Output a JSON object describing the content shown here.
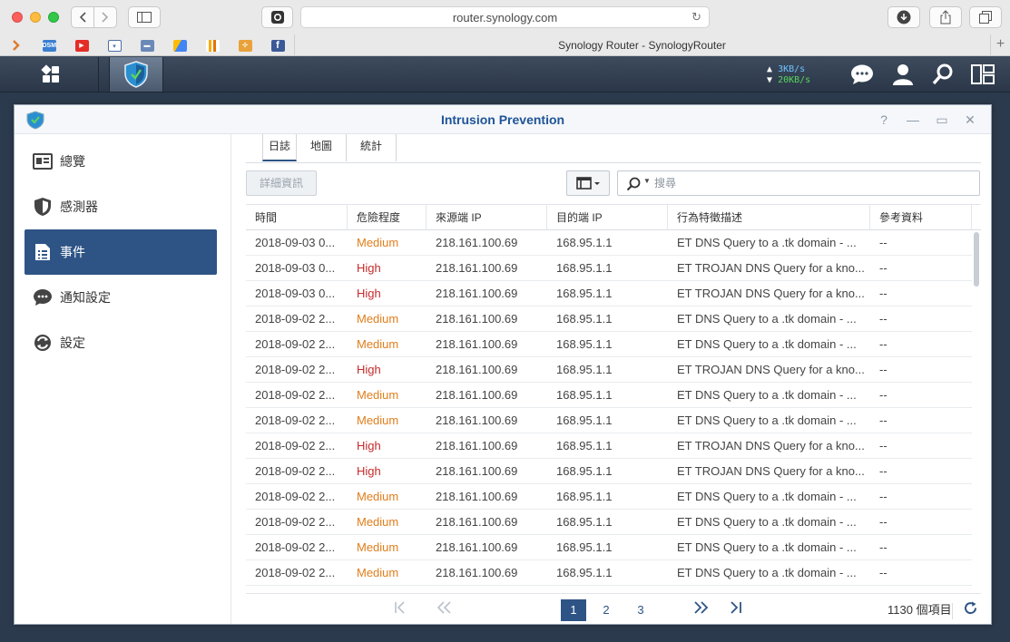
{
  "browser": {
    "url": "router.synology.com",
    "tab_title": "Synology Router - SynologyRouter",
    "favorites": [
      {
        "icon": "chevron-right-icon",
        "color": "#e07b28"
      },
      {
        "icon": "dsm-icon",
        "color": "#3a7fd0",
        "text": "DSM"
      },
      {
        "icon": "youtube-icon",
        "color": "#e52d27"
      },
      {
        "icon": "calendar-icon",
        "color": "#4a6fa8"
      },
      {
        "icon": "car-icon",
        "color": "#6b89b8"
      },
      {
        "icon": "google-ads-icon",
        "color": "#4285f4"
      },
      {
        "icon": "analytics-icon",
        "color": "#f4a124"
      },
      {
        "icon": "puzzle-icon",
        "color": "#e9a23b"
      },
      {
        "icon": "facebook-icon",
        "color": "#3b5998",
        "text": "f"
      }
    ]
  },
  "taskbar": {
    "upload_speed": "3KB/s",
    "download_speed": "20KB/s"
  },
  "window": {
    "title": "Intrusion Prevention"
  },
  "sidebar": {
    "items": [
      {
        "label": "總覽",
        "icon": "overview-icon"
      },
      {
        "label": "感測器",
        "icon": "shield-icon"
      },
      {
        "label": "事件",
        "icon": "event-list-icon",
        "active": true
      },
      {
        "label": "通知設定",
        "icon": "chat-bubble-icon"
      },
      {
        "label": "設定",
        "icon": "settings-sync-icon"
      }
    ]
  },
  "tabs": [
    {
      "label": "日誌",
      "active": true
    },
    {
      "label": "地圖"
    },
    {
      "label": "統計"
    }
  ],
  "toolbar": {
    "detail_button": "詳細資訊",
    "search_placeholder": "搜尋"
  },
  "table": {
    "columns": [
      "時間",
      "危險程度",
      "來源端 IP",
      "目的端 IP",
      "行為特徵描述",
      "參考資料"
    ],
    "rows": [
      [
        "2018-09-03 0...",
        "Medium",
        "218.161.100.69",
        "168.95.1.1",
        "ET DNS Query to a .tk domain - ...",
        "--"
      ],
      [
        "2018-09-03 0...",
        "High",
        "218.161.100.69",
        "168.95.1.1",
        "ET TROJAN DNS Query for a kno...",
        "--"
      ],
      [
        "2018-09-03 0...",
        "High",
        "218.161.100.69",
        "168.95.1.1",
        "ET TROJAN DNS Query for a kno...",
        "--"
      ],
      [
        "2018-09-02 2...",
        "Medium",
        "218.161.100.69",
        "168.95.1.1",
        "ET DNS Query to a .tk domain - ...",
        "--"
      ],
      [
        "2018-09-02 2...",
        "Medium",
        "218.161.100.69",
        "168.95.1.1",
        "ET DNS Query to a .tk domain - ...",
        "--"
      ],
      [
        "2018-09-02 2...",
        "High",
        "218.161.100.69",
        "168.95.1.1",
        "ET TROJAN DNS Query for a kno...",
        "--"
      ],
      [
        "2018-09-02 2...",
        "Medium",
        "218.161.100.69",
        "168.95.1.1",
        "ET DNS Query to a .tk domain - ...",
        "--"
      ],
      [
        "2018-09-02 2...",
        "Medium",
        "218.161.100.69",
        "168.95.1.1",
        "ET DNS Query to a .tk domain - ...",
        "--"
      ],
      [
        "2018-09-02 2...",
        "High",
        "218.161.100.69",
        "168.95.1.1",
        "ET TROJAN DNS Query for a kno...",
        "--"
      ],
      [
        "2018-09-02 2...",
        "High",
        "218.161.100.69",
        "168.95.1.1",
        "ET TROJAN DNS Query for a kno...",
        "--"
      ],
      [
        "2018-09-02 2...",
        "Medium",
        "218.161.100.69",
        "168.95.1.1",
        "ET DNS Query to a .tk domain - ...",
        "--"
      ],
      [
        "2018-09-02 2...",
        "Medium",
        "218.161.100.69",
        "168.95.1.1",
        "ET DNS Query to a .tk domain - ...",
        "--"
      ],
      [
        "2018-09-02 2...",
        "Medium",
        "218.161.100.69",
        "168.95.1.1",
        "ET DNS Query to a .tk domain - ...",
        "--"
      ],
      [
        "2018-09-02 2...",
        "Medium",
        "218.161.100.69",
        "168.95.1.1",
        "ET DNS Query to a .tk domain - ...",
        "--"
      ],
      [
        "2018-09-02 2...",
        "High",
        "218.161.100.69",
        "168.95.1.1",
        "ET TROJAN DNS Query for a kno...",
        "--"
      ]
    ]
  },
  "pager": {
    "pages": [
      "1",
      "2",
      "3"
    ],
    "current": "1",
    "count": "1130 個項目"
  },
  "colors": {
    "accent": "#2e5486",
    "medium": "#e07e1b",
    "high": "#c52a2a"
  }
}
